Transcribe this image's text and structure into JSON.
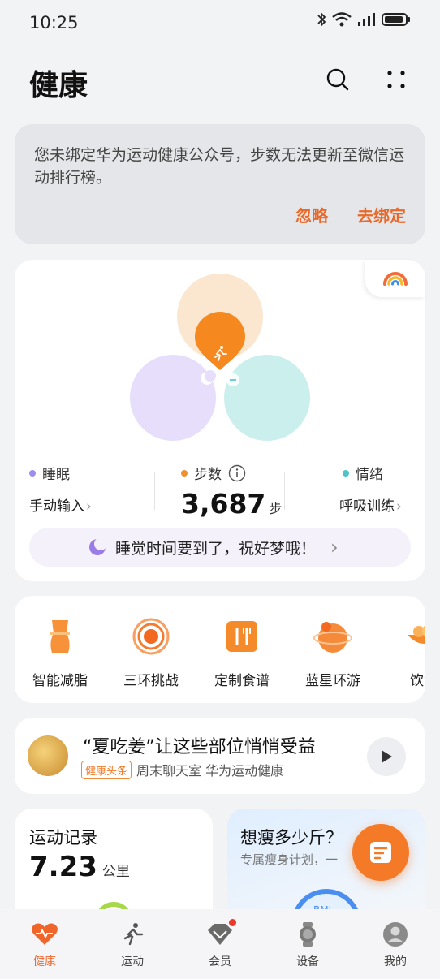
{
  "status_bar": {
    "time": "10:25"
  },
  "header": {
    "title": "健康"
  },
  "bind_notice": {
    "message": "您未绑定华为运动健康公众号，步数无法更新至微信运动排行榜。",
    "ignore_label": "忽略",
    "bind_label": "去绑定"
  },
  "health_summary": {
    "sleep": {
      "name": "睡眠",
      "sub": "手动输入",
      "color": "#9b8ef0"
    },
    "steps": {
      "name": "步数",
      "value": "3,687",
      "unit": "步",
      "color": "#f0912e"
    },
    "mood": {
      "name": "情绪",
      "sub": "呼吸训练",
      "color": "#4fc3c7"
    },
    "tip": "睡觉时间要到了，祝好梦哦！"
  },
  "features": [
    {
      "label": "智能减脂",
      "icon": "body-shape-icon"
    },
    {
      "label": "三环挑战",
      "icon": "rings-challenge-icon"
    },
    {
      "label": "定制食谱",
      "icon": "recipe-icon"
    },
    {
      "label": "蓝星环游",
      "icon": "planet-travel-icon"
    },
    {
      "label": "饮食",
      "icon": "food-bowl-icon"
    }
  ],
  "article": {
    "title": "“夏吃姜”让这些部位悄悄受益",
    "tag": "健康头条",
    "meta": "周末聊天室 华为运动健康"
  },
  "exercise_record": {
    "title": "运动记录",
    "value": "7.23",
    "unit": "公里"
  },
  "slim_plan": {
    "title": "想瘦多少斤？",
    "subtitle": "专属瘦身计划，一",
    "bmi_label": "BMI"
  },
  "tabs": [
    {
      "label": "健康",
      "active": true
    },
    {
      "label": "运动",
      "active": false
    },
    {
      "label": "会员",
      "active": false
    },
    {
      "label": "设备",
      "active": false
    },
    {
      "label": "我的",
      "active": false
    }
  ],
  "colors": {
    "accent": "#f0652a",
    "steps_orange": "#f5891f",
    "sleep_purple": "#e6dcfb",
    "mood_teal": "#c9eeec"
  }
}
